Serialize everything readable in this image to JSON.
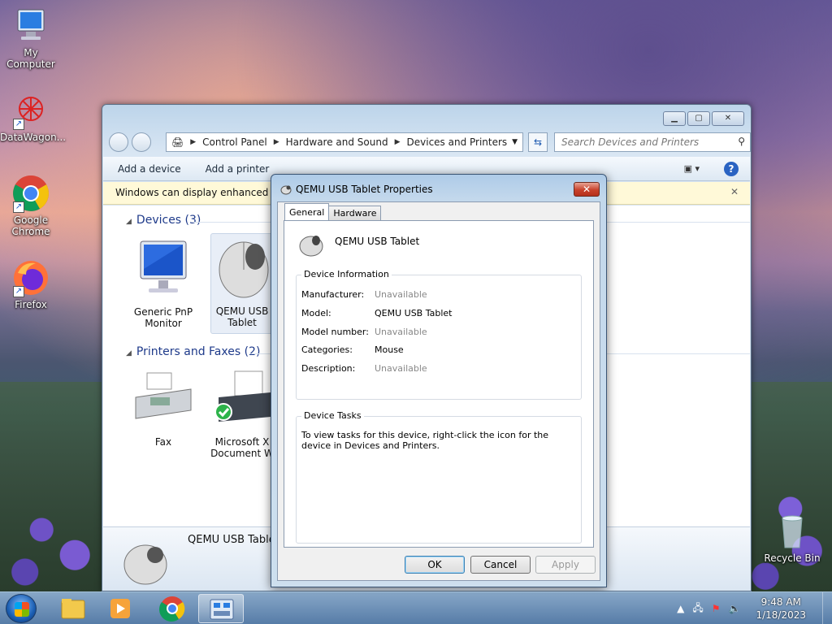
{
  "desktop": {
    "icons": [
      {
        "label": "My Computer"
      },
      {
        "label": "DataWagon..."
      },
      {
        "label": "Google Chrome"
      },
      {
        "label": "Firefox"
      },
      {
        "label": "Recycle Bin"
      }
    ]
  },
  "explorer": {
    "breadcrumb": [
      "Control Panel",
      "Hardware and Sound",
      "Devices and Printers"
    ],
    "search_placeholder": "Search Devices and Printers",
    "toolbar": {
      "add_device": "Add a device",
      "add_printer": "Add a printer",
      "help": "?"
    },
    "infobar": "Windows can display enhanced devi",
    "groups": [
      {
        "title": "Devices (3)",
        "items": [
          "Generic PnP Monitor",
          "QEMU USB Tablet"
        ]
      },
      {
        "title": "Printers and Faxes (2)",
        "items": [
          "Fax",
          "Microsoft X Document W"
        ]
      }
    ],
    "details_name": "QEMU USB Tablet"
  },
  "dialog": {
    "title": "QEMU USB Tablet Properties",
    "tabs": [
      "General",
      "Hardware"
    ],
    "device_name": "QEMU USB Tablet",
    "info_legend": "Device Information",
    "info": [
      {
        "key": "Manufacturer:",
        "value": "Unavailable",
        "muted": true
      },
      {
        "key": "Model:",
        "value": "QEMU USB Tablet",
        "muted": false
      },
      {
        "key": "Model number:",
        "value": "Unavailable",
        "muted": true
      },
      {
        "key": "Categories:",
        "value": "Mouse",
        "muted": false
      },
      {
        "key": "Description:",
        "value": "Unavailable",
        "muted": true
      }
    ],
    "tasks_legend": "Device Tasks",
    "tasks_text": "To view tasks for this device, right-click the icon for the device in Devices and Printers.",
    "buttons": {
      "ok": "OK",
      "cancel": "Cancel",
      "apply": "Apply"
    }
  },
  "taskbar": {
    "time": "9:48 AM",
    "date": "1/18/2023"
  }
}
